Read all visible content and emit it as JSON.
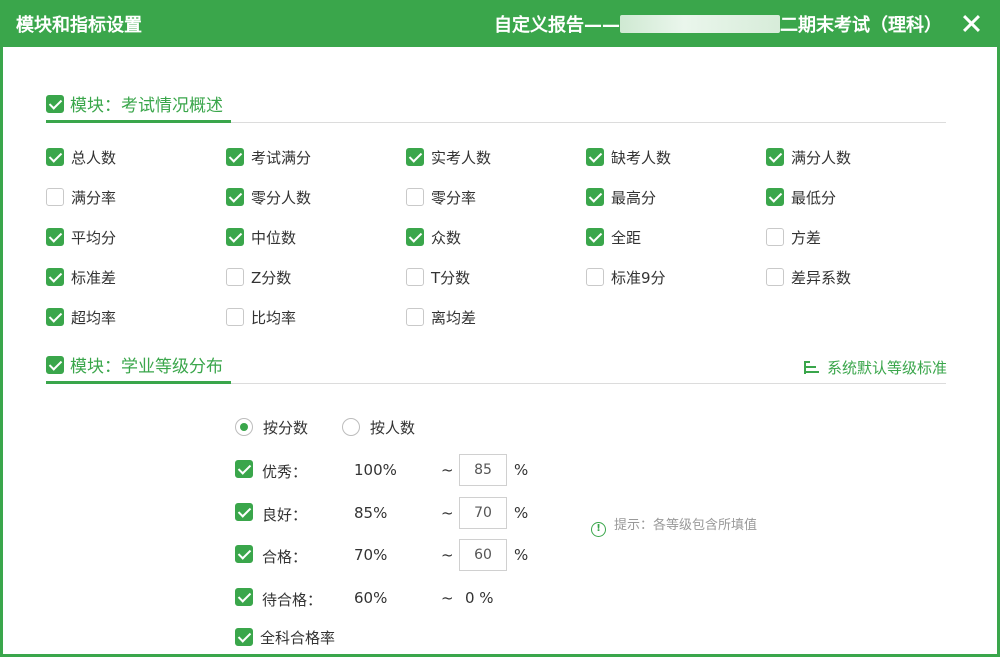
{
  "titlebar": {
    "left_title": "模块和指标设置",
    "report_prefix": "自定义报告——",
    "report_suffix": "二期末考试（理科）"
  },
  "sections": [
    {
      "title": "模块：考试情况概述",
      "checked": true,
      "items": [
        {
          "label": "总人数",
          "checked": true
        },
        {
          "label": "考试满分",
          "checked": true
        },
        {
          "label": "实考人数",
          "checked": true
        },
        {
          "label": "缺考人数",
          "checked": true
        },
        {
          "label": "满分人数",
          "checked": true
        },
        {
          "label": "满分率",
          "checked": false
        },
        {
          "label": "零分人数",
          "checked": true
        },
        {
          "label": "零分率",
          "checked": false
        },
        {
          "label": "最高分",
          "checked": true
        },
        {
          "label": "最低分",
          "checked": true
        },
        {
          "label": "平均分",
          "checked": true
        },
        {
          "label": "中位数",
          "checked": true
        },
        {
          "label": "众数",
          "checked": true
        },
        {
          "label": "全距",
          "checked": true
        },
        {
          "label": "方差",
          "checked": false
        },
        {
          "label": "标准差",
          "checked": true
        },
        {
          "label": "Z分数",
          "checked": false
        },
        {
          "label": "T分数",
          "checked": false
        },
        {
          "label": "标准9分",
          "checked": false
        },
        {
          "label": "差异系数",
          "checked": false
        },
        {
          "label": "超均率",
          "checked": true
        },
        {
          "label": "比均率",
          "checked": false
        },
        {
          "label": "离均差",
          "checked": false
        }
      ]
    },
    {
      "title": "模块：学业等级分布",
      "checked": true,
      "link_label": "系统默认等级标准",
      "radios": [
        {
          "label": "按分数",
          "selected": true
        },
        {
          "label": "按人数",
          "selected": false
        }
      ],
      "levels": [
        {
          "name": "优秀：",
          "upper": "100%",
          "tilde": "~",
          "lower": "85",
          "unit": "%",
          "checked": true
        },
        {
          "name": "良好：",
          "upper": "85%",
          "tilde": "~",
          "lower": "70",
          "unit": "%",
          "checked": true
        },
        {
          "name": "合格：",
          "upper": "70%",
          "tilde": "~",
          "lower": "60",
          "unit": "%",
          "checked": true
        },
        {
          "name": "待合格：",
          "upper": "60%",
          "tilde": "~",
          "lower_fixed": "0 %",
          "checked": true
        }
      ],
      "all_pass": {
        "label": "全科合格率",
        "checked": true
      },
      "hint": "提示：各等级包含所填值"
    }
  ],
  "colors": {
    "accent": "#3aa64b",
    "divider": "#dcdcdc"
  },
  "icons": {
    "close": "close-icon",
    "list": "list-icon",
    "info": "info-icon",
    "check": "checkbox-check-icon"
  }
}
